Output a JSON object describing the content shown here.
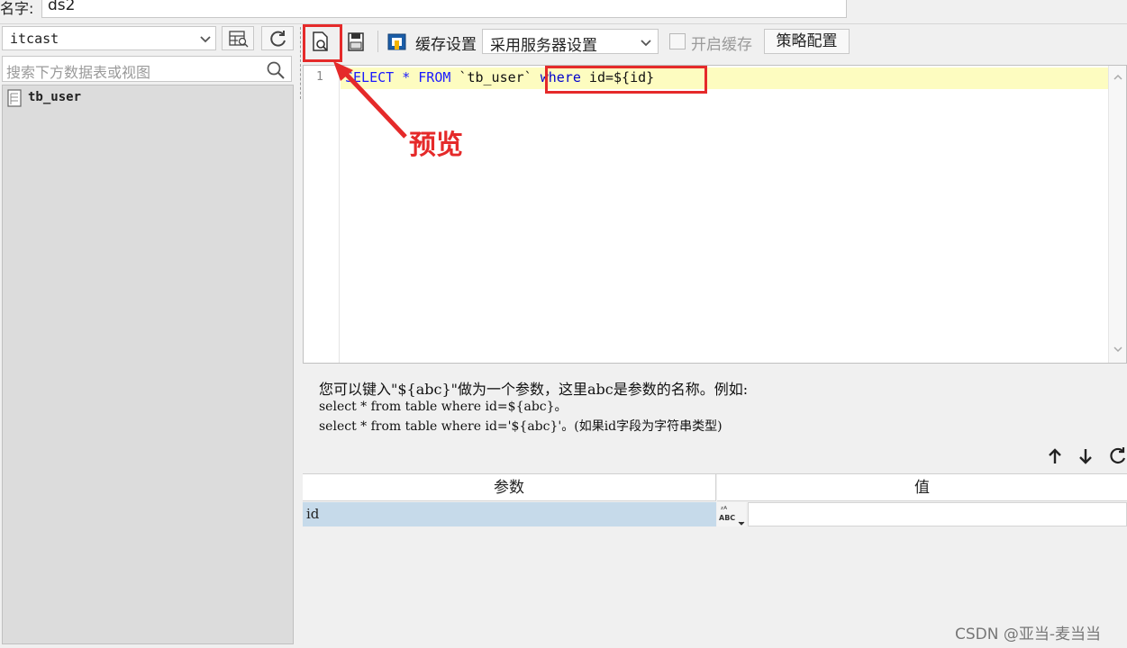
{
  "name_row": {
    "label": "名字:",
    "value": "ds2"
  },
  "left_panel": {
    "database": "itcast",
    "search_placeholder": "搜索下方数据表或视图",
    "tables": [
      "tb_user"
    ]
  },
  "toolbar": {
    "cache_label": "缓存设置",
    "cache_option": "采用服务器设置",
    "cache_checkbox_label": "开启缓存",
    "strategy_button": "策略配置"
  },
  "editor": {
    "line_number": "1",
    "sql_select": "SELECT",
    "sql_star": " * ",
    "sql_from": "FROM",
    "sql_table": " `tb_user` ",
    "sql_where": "where",
    "sql_condition": " id=${id}"
  },
  "annotation": {
    "label": "预览"
  },
  "help": {
    "line1": "您可以键入\"${abc}\"做为一个参数，这里abc是参数的名称。例如:",
    "line2": "select * from table where id=${abc}。",
    "line3": "select * from table where id='${abc}'。(如果id字段为字符串类型)"
  },
  "param_table": {
    "header_param": "参数",
    "header_value": "值",
    "rows": [
      {
        "param": "id",
        "value": ""
      }
    ]
  },
  "watermark": "CSDN @亚当-麦当当",
  "colors": {
    "annotation_red": "#e52a2a",
    "selected_row": "#c6daea",
    "active_line": "#fdfcc0",
    "keyword_blue": "#1a1aff"
  }
}
